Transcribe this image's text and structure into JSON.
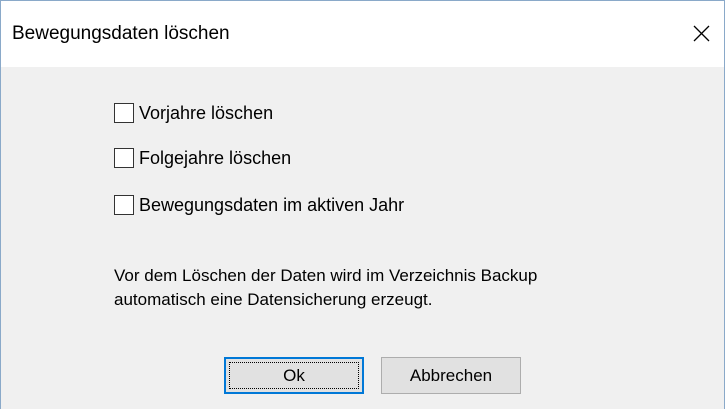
{
  "window": {
    "title": "Bewegungsdaten löschen",
    "close_icon": "close-icon"
  },
  "options": [
    {
      "label": "Vorjahre löschen",
      "checked": false
    },
    {
      "label": "Folgejahre löschen",
      "checked": false
    },
    {
      "label": "Bewegungsdaten im aktiven Jahr",
      "checked": false
    }
  ],
  "info": {
    "line1": "Vor dem Löschen der Daten wird im Verzeichnis Backup",
    "line2": "automatisch eine Datensicherung erzeugt."
  },
  "buttons": {
    "ok_label": "Ok",
    "cancel_label": "Abbrechen"
  },
  "colors": {
    "accent": "#0078d7",
    "window_border": "#8aa9c9"
  }
}
